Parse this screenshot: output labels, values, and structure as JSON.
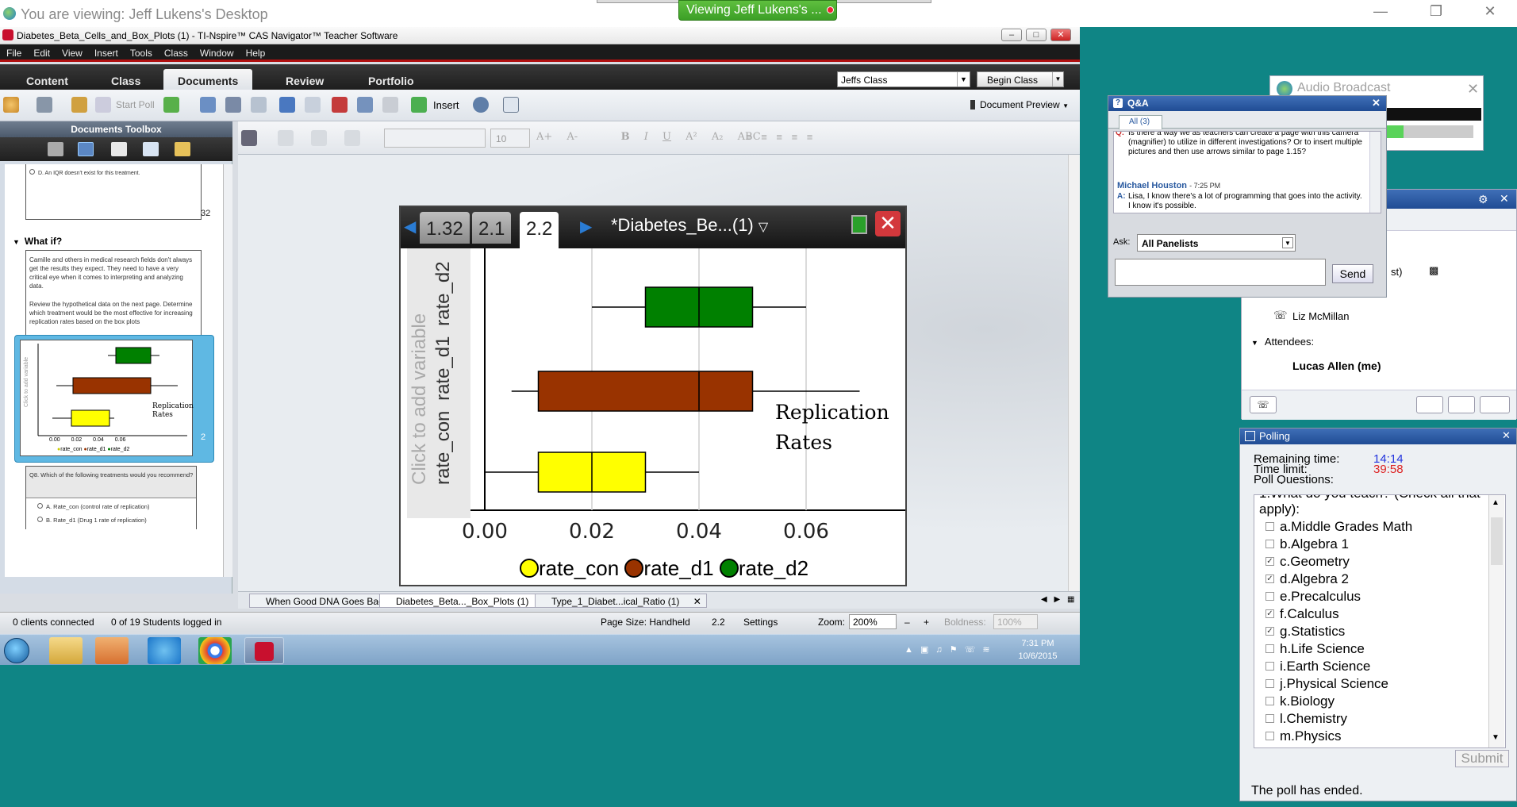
{
  "viewer": {
    "title": "You are viewing: Jeff Lukens's Desktop",
    "pill": "Viewing Jeff Lukens's ..."
  },
  "app": {
    "title": "Diabetes_Beta_Cells_and_Box_Plots (1) - TI-Nspire™ CAS Navigator™ Teacher Software",
    "menu": [
      "File",
      "Edit",
      "View",
      "Insert",
      "Tools",
      "Class",
      "Window",
      "Help"
    ],
    "tabs": [
      "Content",
      "Class",
      "Documents",
      "Review",
      "Portfolio"
    ],
    "active_tab": "Documents",
    "class_select": "Jeffs Class",
    "begin_class": "Begin Class",
    "start_poll": "Start Poll",
    "insert": "Insert",
    "document_preview": "Document Preview",
    "font_size": "10"
  },
  "toolbox": {
    "title": "Documents Toolbox",
    "option_d": "D. An IQR doesn't exist for this treatment.",
    "page_32": "32",
    "section": "What if?",
    "para1": "Camille and others in medical research fields don't always get the results they expect. They need to have a very critical eye when it comes to interpreting and analyzing data.",
    "para2": "Review the hypothetical data on the next page. Determine which treatment would be the most effective for increasing replication rates based on the box plots",
    "page_1": "1",
    "page_2": "2",
    "q8": "Q8. Which of the following treatments would you recommend?",
    "q8a": "A. Rate_con (control rate of replication)",
    "q8b": "B. Rate_d1 (Drug 1 rate of replication)"
  },
  "handheld": {
    "tabs": [
      "1.32",
      "2.1",
      "2.2"
    ],
    "active_tab": "2.2",
    "doc_title": "*Diabetes_Be...(1)"
  },
  "chart_data": {
    "type": "boxplot",
    "x_ticks": [
      "0.00",
      "0.02",
      "0.04",
      "0.06"
    ],
    "xlim": [
      0.0,
      0.08
    ],
    "grid": true,
    "y_hint": "Click to add variable",
    "y_labels": [
      "rate_con",
      "rate_d1",
      "rate_d2"
    ],
    "annotation": [
      "Replication",
      "Rates"
    ],
    "legend": [
      "rate_con",
      "rate_d1",
      "rate_d2"
    ],
    "colors": [
      "#ffff00",
      "#993300",
      "#008000"
    ],
    "series": [
      {
        "name": "rate_con",
        "min": 0.0,
        "q1": 0.01,
        "median": 0.02,
        "q3": 0.03,
        "max": 0.04
      },
      {
        "name": "rate_d1",
        "min": 0.005,
        "q1": 0.01,
        "median": 0.04,
        "q3": 0.05,
        "max": 0.07
      },
      {
        "name": "rate_d2",
        "min": 0.02,
        "q1": 0.03,
        "median": 0.04,
        "q3": 0.05,
        "max": 0.06
      }
    ]
  },
  "file_tabs": [
    "When Good DNA Goes Bad",
    "Diabetes_Beta..._Box_Plots (1)",
    "Type_1_Diabet...ical_Ratio (1)"
  ],
  "status": {
    "clients": "0 clients connected",
    "students": "0 of 19 Students logged in",
    "page_size": "Page Size: Handheld",
    "page": "2.2",
    "settings": "Settings",
    "zoom_label": "Zoom:",
    "zoom": "200%",
    "boldness_label": "Boldness:",
    "boldness": "100%"
  },
  "taskbar": {
    "time": "7:31 PM",
    "date": "10/6/2015"
  },
  "qa": {
    "title": "Q&A",
    "tab": "All (3)",
    "question": "Is there a way we as teachers can create a page with this camera (magnifier) to utilize in different investigations? Or to insert multiple pictures and then use arrows similar to page 1.15?",
    "q_prefix": "Q:",
    "answerer": "Michael Houston",
    "answer_time": "- 7:25 PM",
    "a_prefix": "A:",
    "answer": "Lisa, I know there's a lot of programming that goes into the activity.  I know it's possible.",
    "ask_label": "Ask:",
    "ask_value": "All Panelists",
    "send": "Send"
  },
  "audio": {
    "title": "Audio Broadcast"
  },
  "attendees": {
    "partial": "st)",
    "panelist": "Liz McMillan",
    "section": "Attendees:",
    "me": "Lucas Allen (me)"
  },
  "polling": {
    "title": "Polling",
    "remaining_label": "Remaining time:",
    "remaining": "14:14",
    "limit_label": "Time limit:",
    "limit": "39:58",
    "questions_label": "Poll Questions:",
    "question": "1.What do you teach? (Check all that apply):",
    "options": [
      {
        "label": "a.Middle Grades Math",
        "checked": false
      },
      {
        "label": "b.Algebra 1",
        "checked": false
      },
      {
        "label": "c.Geometry",
        "checked": true
      },
      {
        "label": "d.Algebra 2",
        "checked": true
      },
      {
        "label": "e.Precalculus",
        "checked": false
      },
      {
        "label": "f.Calculus",
        "checked": true
      },
      {
        "label": "g.Statistics",
        "checked": true
      },
      {
        "label": "h.Life Science",
        "checked": false
      },
      {
        "label": "i.Earth Science",
        "checked": false
      },
      {
        "label": "j.Physical Science",
        "checked": false
      },
      {
        "label": "k.Biology",
        "checked": false
      },
      {
        "label": "l.Chemistry",
        "checked": false
      },
      {
        "label": "m.Physics",
        "checked": false
      }
    ],
    "submit": "Submit",
    "ended": "The poll has ended."
  }
}
